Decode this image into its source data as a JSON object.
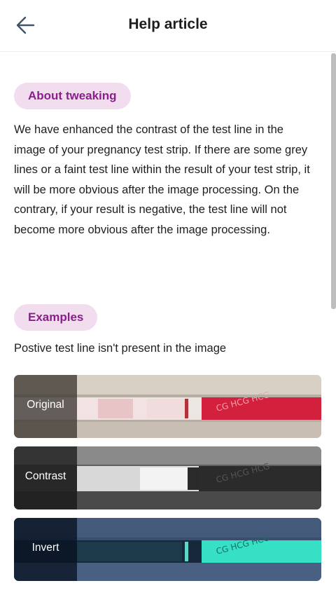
{
  "header": {
    "title": "Help article",
    "back_icon": "arrow-left-icon"
  },
  "about": {
    "chip": "About tweaking",
    "body": "We have enhanced the contrast of the test line in the image of your pregnancy test strip. If there are some grey lines or a faint test line within the result of your test strip, it will be more obvious after the image processing. On the contrary, if your result is negative, the test line will not become more obvious after the image processing."
  },
  "examples": {
    "chip": "Examples",
    "caption": "Postive test line isn't present in the image",
    "items": [
      {
        "label": "Original"
      },
      {
        "label": "Contrast"
      },
      {
        "label": "Invert"
      }
    ]
  },
  "colors": {
    "chip_bg": "#f1ddee",
    "chip_text": "#8a1f8c",
    "back_icon": "#41536b"
  }
}
